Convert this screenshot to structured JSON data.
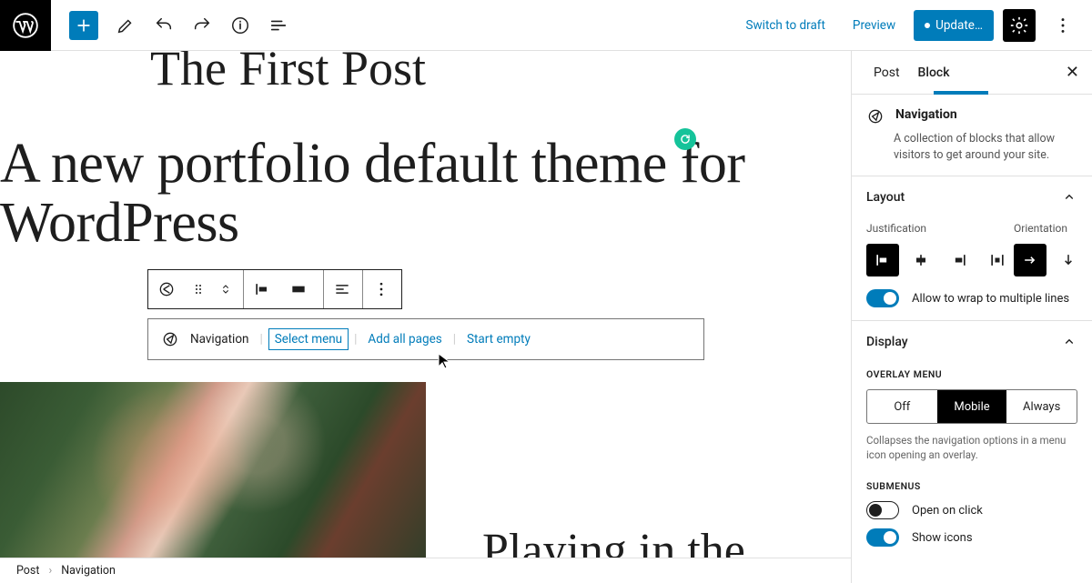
{
  "topbar": {
    "switch_to_draft": "Switch to draft",
    "preview": "Preview",
    "update": "Update…"
  },
  "editor": {
    "post_title": "The First Post",
    "heading": "A new portfolio default theme for WordPress",
    "nav_label": "Navigation",
    "select_menu": "Select menu",
    "add_all_pages": "Add all pages",
    "start_empty": "Start empty",
    "next_heading": "Playing in the"
  },
  "breadcrumb": {
    "a": "Post",
    "b": "Navigation"
  },
  "sidebar": {
    "tabs": {
      "post": "Post",
      "block": "Block"
    },
    "block": {
      "title": "Navigation",
      "desc": "A collection of blocks that allow visitors to get around your site."
    },
    "layout": {
      "title": "Layout",
      "justification_label": "Justification",
      "orientation_label": "Orientation",
      "wrap_label": "Allow to wrap to multiple lines"
    },
    "display": {
      "title": "Display",
      "overlay_label": "Overlay Menu",
      "overlay_options": {
        "off": "Off",
        "mobile": "Mobile",
        "always": "Always"
      },
      "overlay_help": "Collapses the navigation options in a menu icon opening an overlay.",
      "submenus_label": "Submenus",
      "open_on_click": "Open on click",
      "show_icons": "Show icons"
    }
  }
}
